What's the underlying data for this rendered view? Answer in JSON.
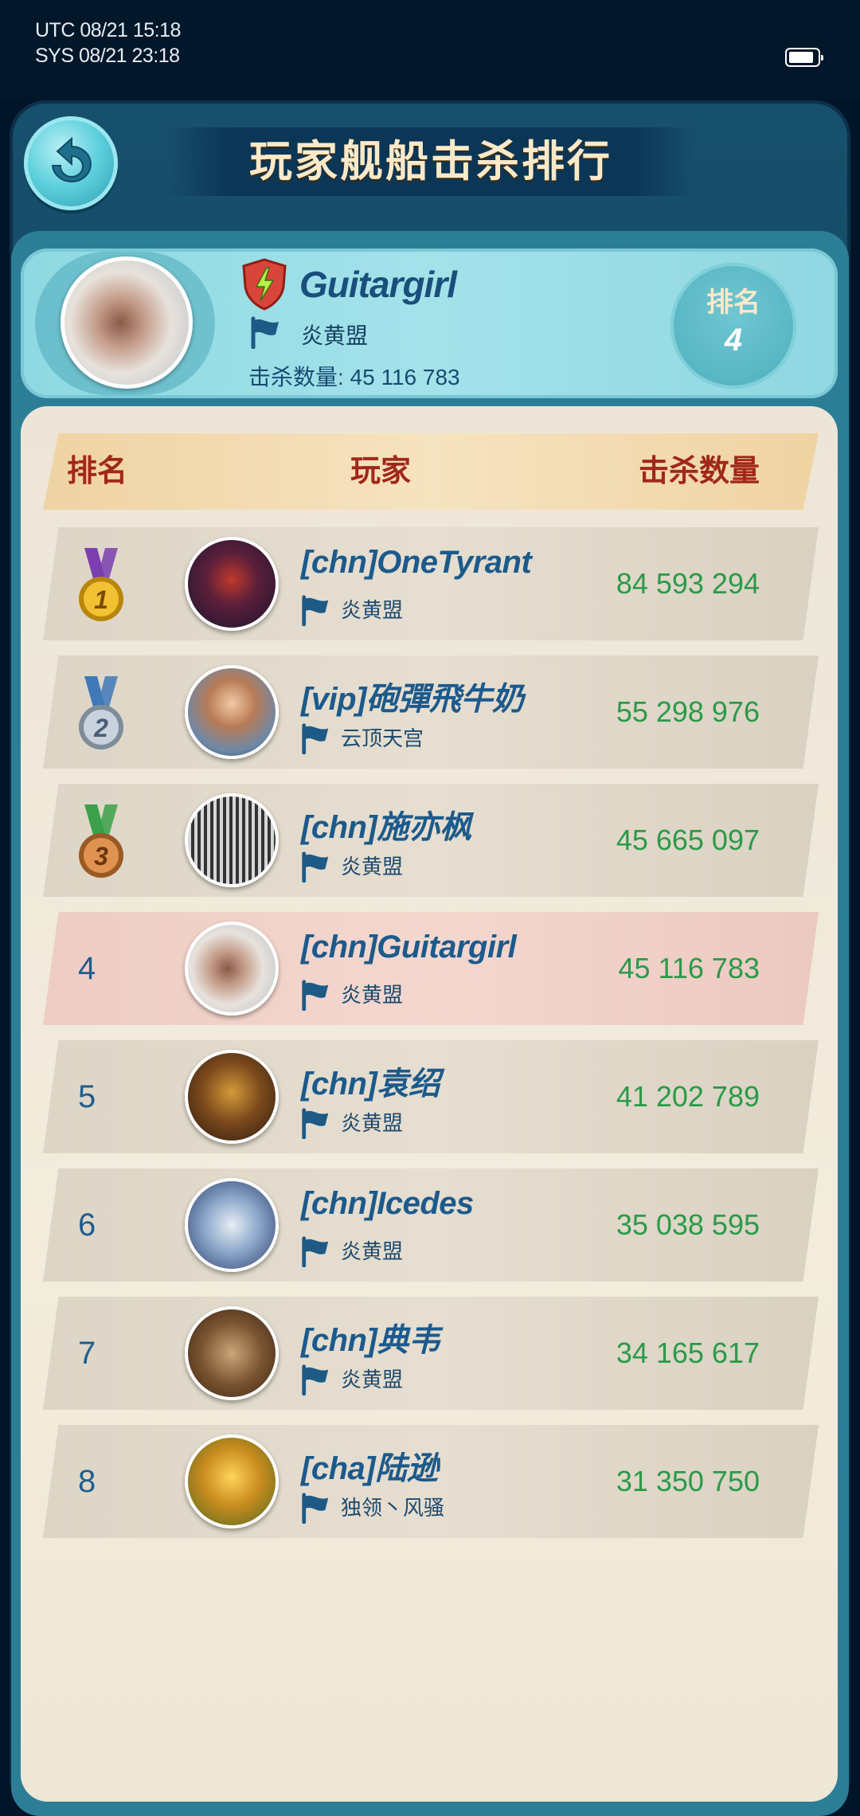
{
  "status_bar": {
    "utc": "UTC 08/21 15:18",
    "sys": "SYS 08/21 23:18"
  },
  "header": {
    "title": "玩家舰船击杀排行"
  },
  "me": {
    "name": "Guitargirl",
    "alliance": "炎黄盟",
    "kills_label": "击杀数量: 45 116 783",
    "rank_label": "排名",
    "rank": "4"
  },
  "table": {
    "headers": {
      "rank": "排名",
      "player": "玩家",
      "kills": "击杀数量"
    },
    "rows": [
      {
        "rank": "1",
        "medal": "gold-medal",
        "name": "[chn]OneTyrant",
        "alliance": "炎黄盟",
        "kills": "84 593 294"
      },
      {
        "rank": "2",
        "medal": "silver-medal",
        "name": "[vip]砲彈飛牛奶",
        "alliance": "云顶天宫",
        "kills": "55 298 976"
      },
      {
        "rank": "3",
        "medal": "bronze-medal",
        "name": "[chn]施亦枫",
        "alliance": "炎黄盟",
        "kills": "45 665 097"
      },
      {
        "rank": "4",
        "name": "[chn]Guitargirl",
        "alliance": "炎黄盟",
        "kills": "45 116 783"
      },
      {
        "rank": "5",
        "name": "[chn]袁绍",
        "alliance": "炎黄盟",
        "kills": "41 202 789"
      },
      {
        "rank": "6",
        "name": "[chn]Icedes",
        "alliance": "炎黄盟",
        "kills": "35 038 595"
      },
      {
        "rank": "7",
        "name": "[chn]典韦",
        "alliance": "炎黄盟",
        "kills": "34 165 617"
      },
      {
        "rank": "8",
        "name": "[cha]陆逊",
        "alliance": "独领丶风骚",
        "kills": "31 350 750"
      }
    ]
  },
  "colors": {
    "accent_name": "#1c5a8c",
    "kills_green": "#2a9a4a",
    "header_red": "#a0281a",
    "highlight_row": "#f3d7cf"
  }
}
